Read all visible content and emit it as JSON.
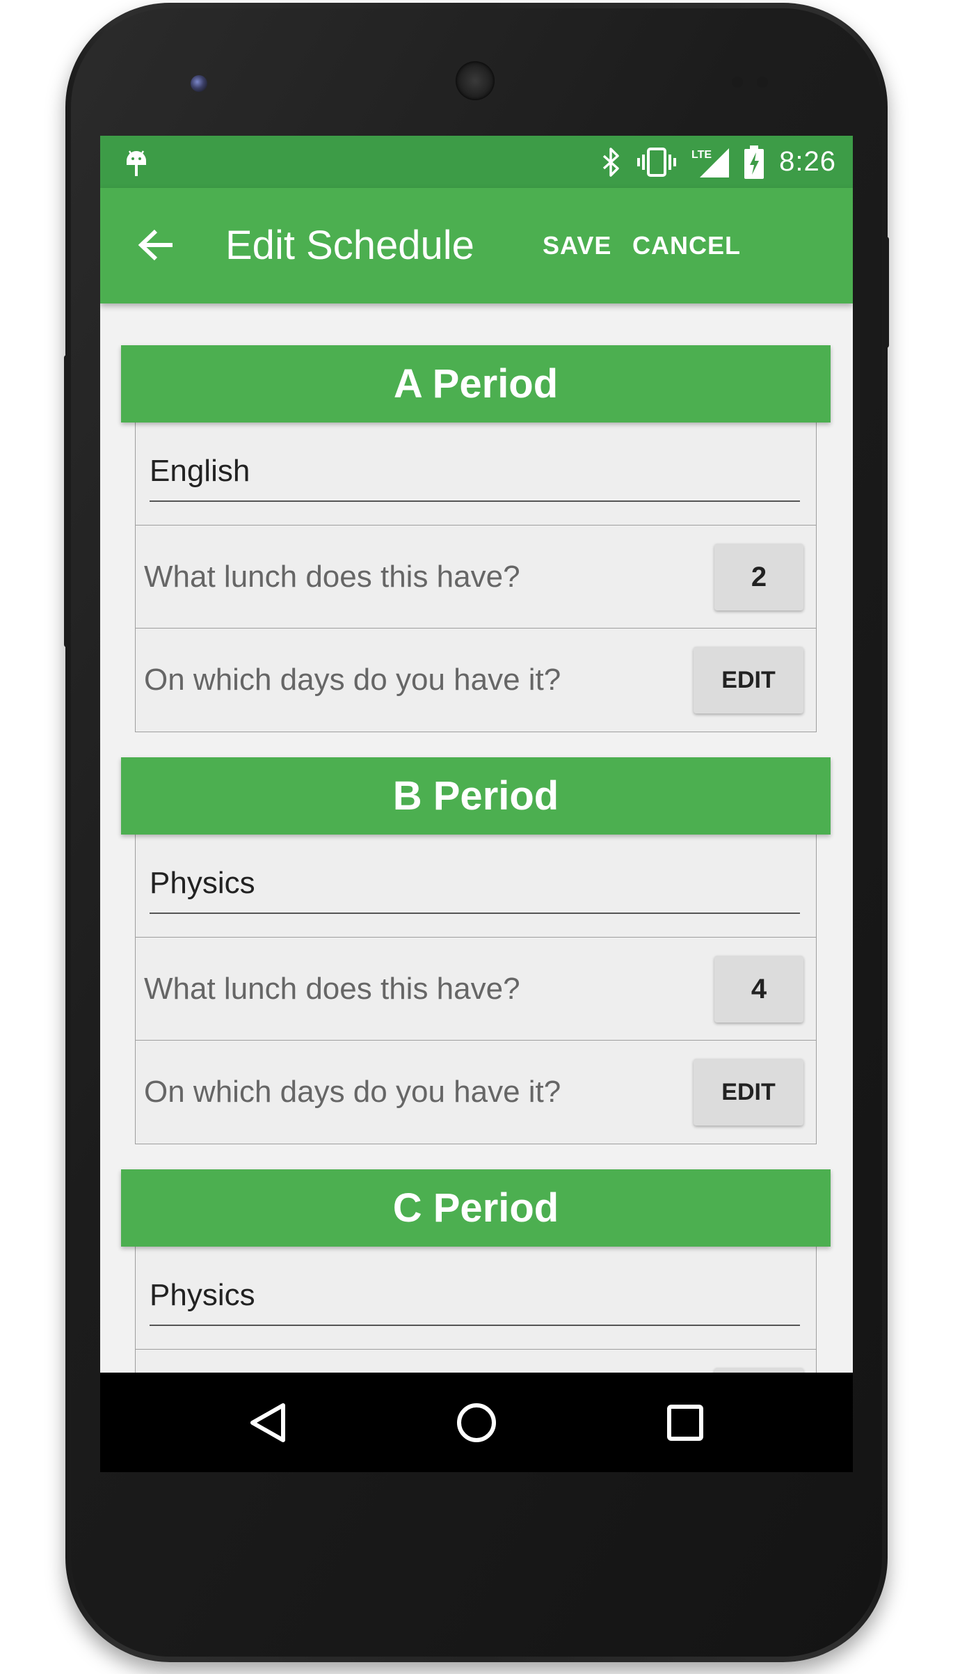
{
  "status_bar": {
    "time": "8:26",
    "icons": [
      "android-icon",
      "bluetooth-icon",
      "vibrate-icon",
      "lte-signal-icon",
      "battery-charging-icon"
    ],
    "lte_label": "LTE"
  },
  "app_bar": {
    "title": "Edit Schedule",
    "save_label": "SAVE",
    "cancel_label": "CANCEL",
    "back_icon": "arrow-back-icon"
  },
  "periods": [
    {
      "header": "A Period",
      "class_name": "English",
      "lunch_question": "What lunch does this have?",
      "lunch_value": "2",
      "days_question": "On which days do you have it?",
      "edit_label": "EDIT"
    },
    {
      "header": "B Period",
      "class_name": "Physics",
      "lunch_question": "What lunch does this have?",
      "lunch_value": "4",
      "days_question": "On which days do you have it?",
      "edit_label": "EDIT"
    },
    {
      "header": "C Period",
      "class_name": "Physics"
    }
  ],
  "nav_bar": {
    "icons": [
      "back-triangle-icon",
      "home-circle-icon",
      "recents-square-icon"
    ]
  },
  "colors": {
    "primary": "#4caf50",
    "primary_dark": "#3d9c47",
    "background": "#f2f2f2",
    "card": "#eeeeee"
  }
}
